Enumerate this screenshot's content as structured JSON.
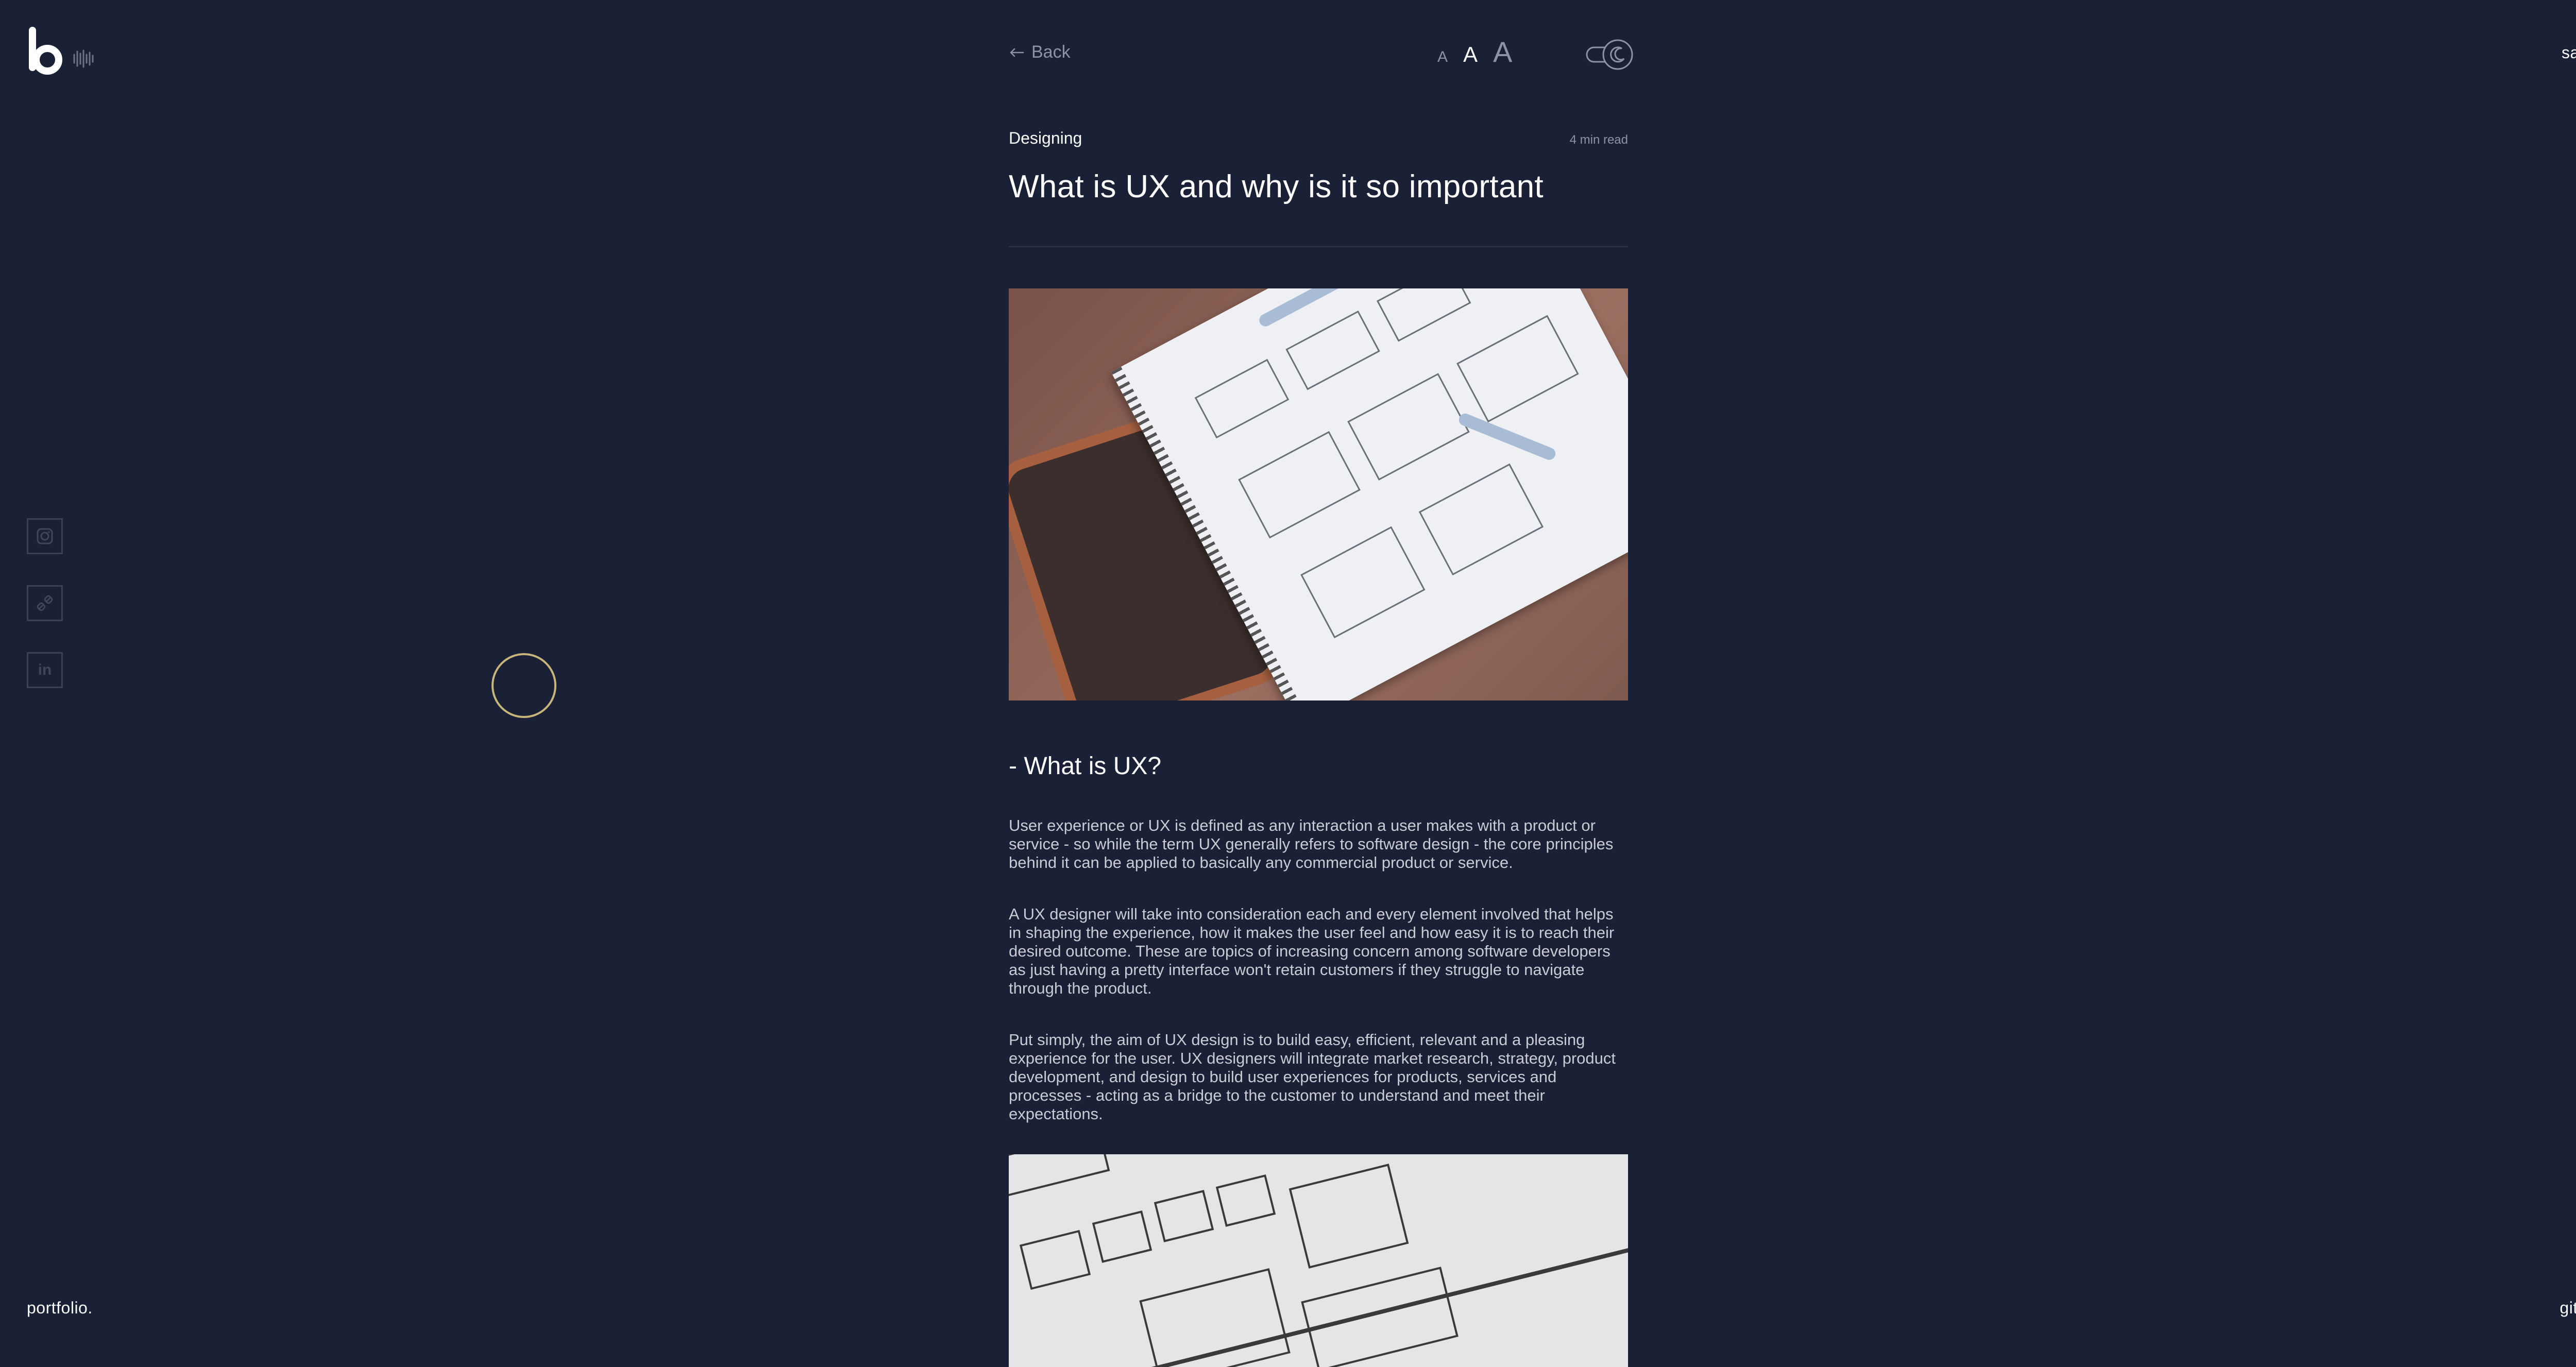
{
  "brand": {
    "logo_letter": "b"
  },
  "nav": {
    "say_hi": "say hi.",
    "portfolio": "portfolio.",
    "github": "github."
  },
  "social": [
    {
      "name": "instagram",
      "icon": "instagram-icon"
    },
    {
      "name": "link",
      "icon": "link-icon"
    },
    {
      "name": "linkedin",
      "icon": "linkedin-icon",
      "label": "in"
    }
  ],
  "toolbar": {
    "back_label": "Back",
    "font_small": "A",
    "font_medium": "A",
    "font_large": "A",
    "theme_toggle_icon": "moon-icon"
  },
  "article": {
    "category": "Designing",
    "read_time": "4 min read",
    "title": "What is UX and why is it so important",
    "section_heading": "- What is UX?",
    "paragraphs": [
      "User experience or UX is defined as any interaction a user makes with a product or service - so while the term UX generally refers to software design - the core principles behind it can be applied to basically any commercial product or service.",
      "A UX designer will take into consideration each and every element involved that helps in shaping the experience, how it makes the user feel and how easy it is to reach their desired outcome. These are topics of increasing concern among software developers as just having a pretty interface won't retain customers if they struggle to navigate through the product.",
      "Put simply, the aim of UX design is to build easy, efficient, relevant and a pleasing experience for the user. UX designers will integrate market research, strategy, product development, and design to build user experiences for products, services and processes - acting as a bridge to the customer to understand and meet their expectations."
    ]
  },
  "colors": {
    "background": "#1a2036",
    "text": "#ffffff",
    "muted": "#8d93a5",
    "body_text": "#c9ccd4",
    "cursor_ring": "#c8b57a"
  }
}
